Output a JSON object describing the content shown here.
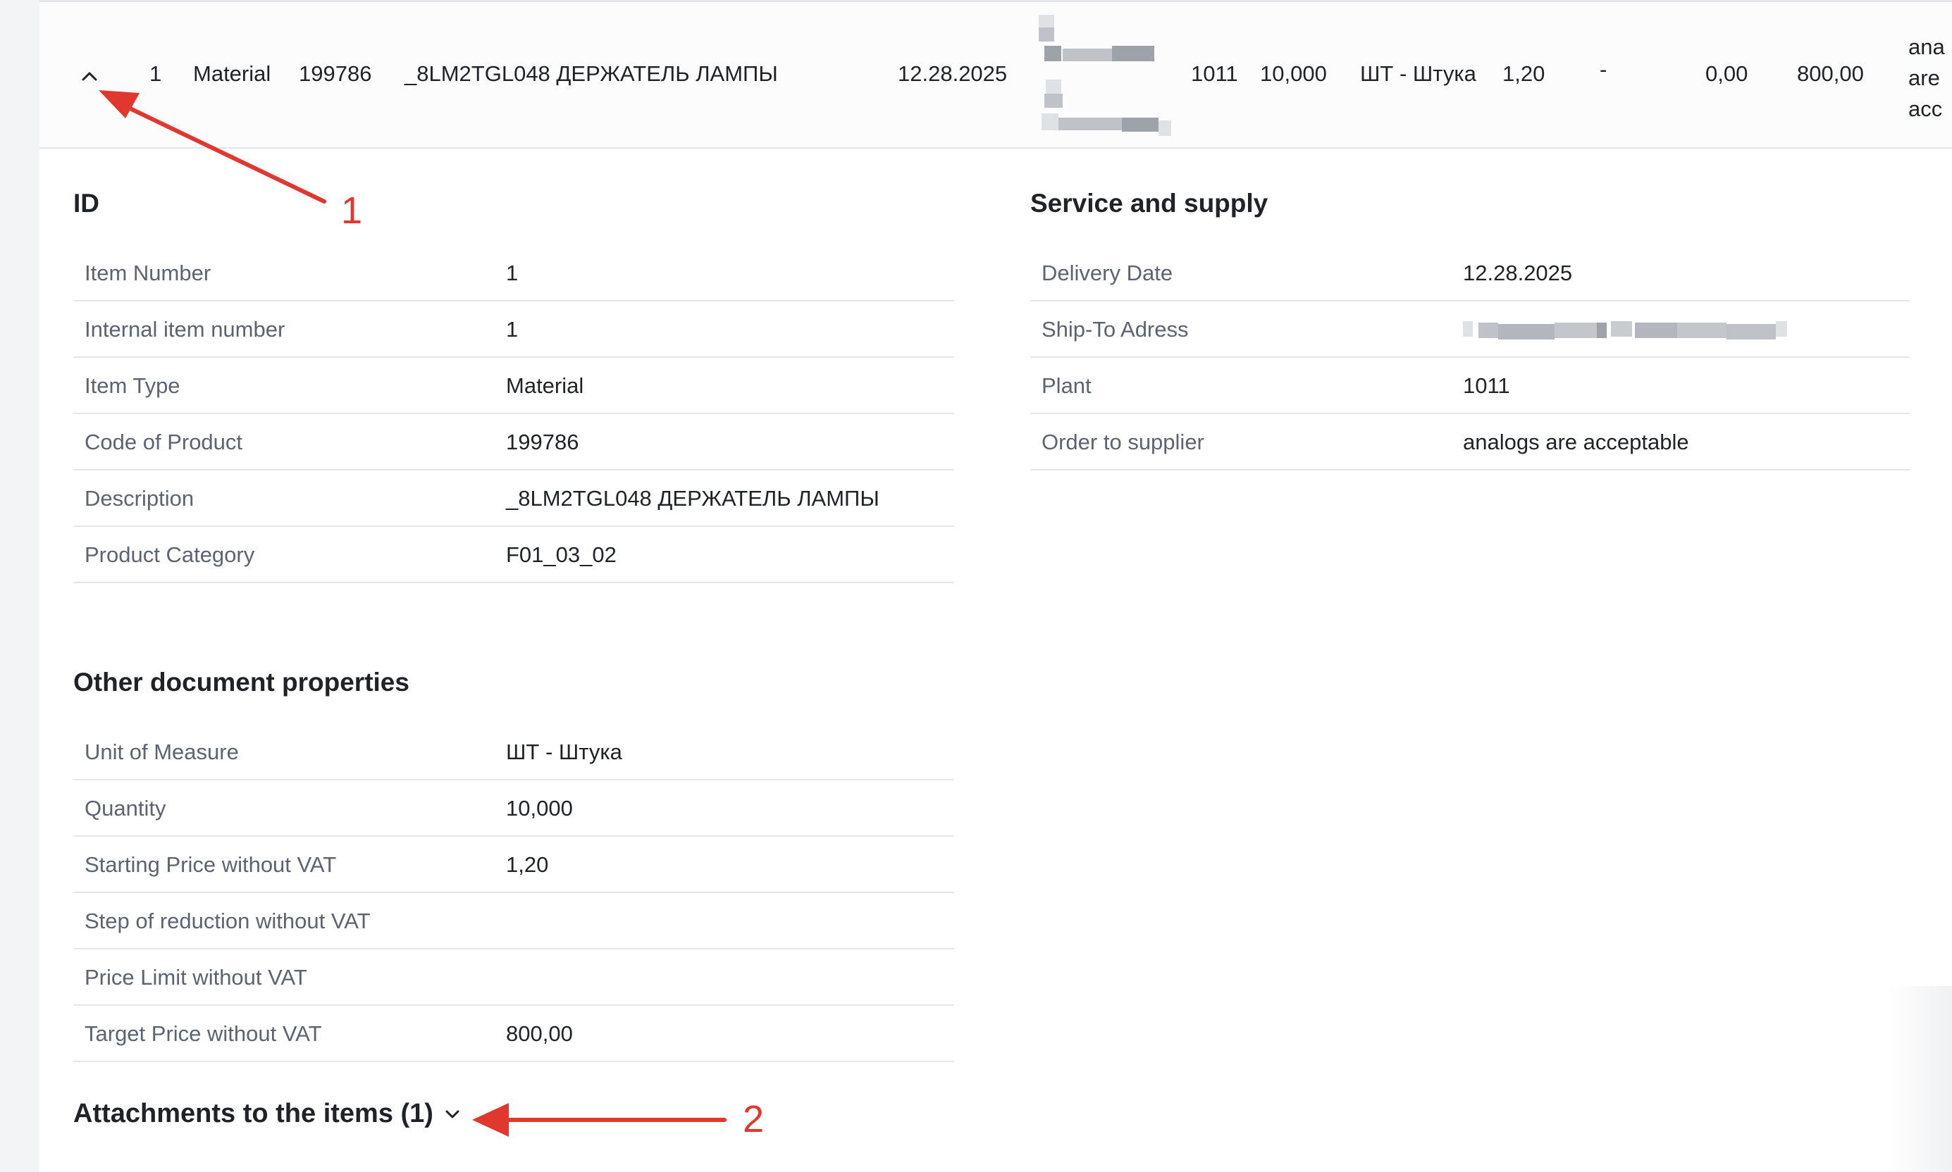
{
  "item_row": {
    "position": "1",
    "item_type": "Material",
    "product_code": "199786",
    "description": "_8LM2TGL048 ДЕРЖАТЕЛЬ ЛАМПЫ",
    "delivery_date": "12.28.2025",
    "plant": "1011",
    "quantity": "10,000",
    "unit": "ШТ - Штука",
    "starting_price": "1,20",
    "step": "-",
    "price_limit": "0,00",
    "target_price": "800,00",
    "comment_truncated": [
      "ana",
      "are",
      "acc"
    ]
  },
  "id_section": {
    "title": "ID",
    "rows": [
      {
        "label": "Item Number",
        "value": "1"
      },
      {
        "label": "Internal item number",
        "value": "1"
      },
      {
        "label": "Item Type",
        "value": "Material"
      },
      {
        "label": "Code of Product",
        "value": "199786"
      },
      {
        "label": "Description",
        "value": "_8LM2TGL048 ДЕРЖАТЕЛЬ ЛАМПЫ"
      },
      {
        "label": "Product Category",
        "value": "F01_03_02"
      }
    ]
  },
  "service_section": {
    "title": "Service and supply",
    "rows": [
      {
        "label": "Delivery Date",
        "value": "12.28.2025"
      },
      {
        "label": "Ship-To Adress",
        "value": ""
      },
      {
        "label": "Plant",
        "value": "1011"
      },
      {
        "label": "Order to supplier",
        "value": "analogs are acceptable"
      }
    ]
  },
  "other_section": {
    "title": "Other document properties",
    "rows": [
      {
        "label": "Unit of Measure",
        "value": "ШТ - Штука"
      },
      {
        "label": "Quantity",
        "value": "10,000"
      },
      {
        "label": "Starting Price without VAT",
        "value": "1,20"
      },
      {
        "label": "Step of reduction without VAT",
        "value": ""
      },
      {
        "label": "Price Limit without VAT",
        "value": ""
      },
      {
        "label": "Target Price without VAT",
        "value": "800,00"
      }
    ]
  },
  "attachments": {
    "label": "Attachments to the items (1)"
  },
  "annotations": {
    "marker_1": "1",
    "marker_2": "2"
  },
  "colors": {
    "annotation_red": "#e0382f",
    "text": "#1f2328",
    "label": "#5b6470",
    "divider": "#e4e6ea"
  }
}
